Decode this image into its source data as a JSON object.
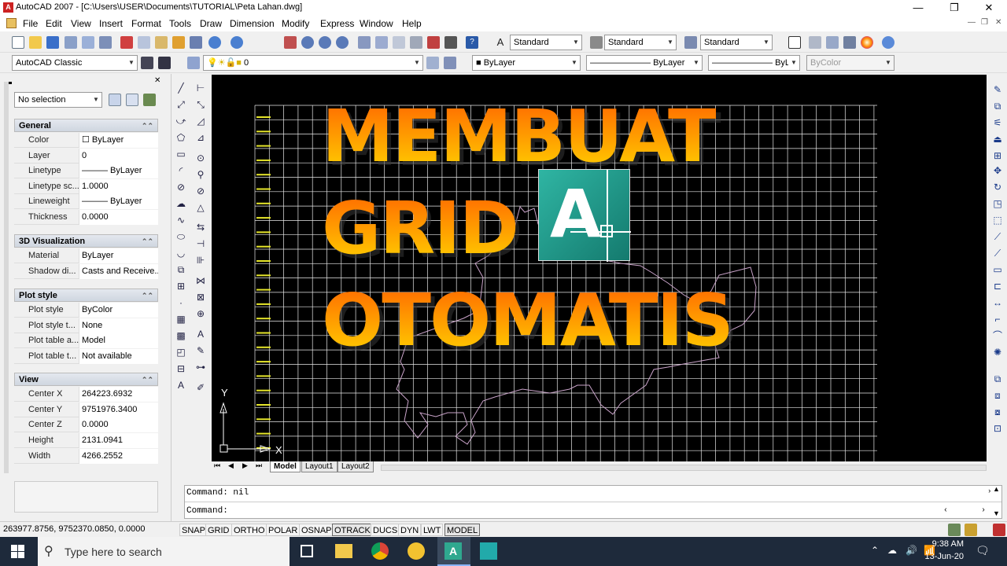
{
  "window": {
    "app_icon": "A",
    "title": "AutoCAD 2007 - [C:\\Users\\USER\\Documents\\TUTORIAL\\Peta Lahan.dwg]",
    "min": "—",
    "max": "❐",
    "close": "✕"
  },
  "menu": {
    "items": [
      "File",
      "Edit",
      "View",
      "Insert",
      "Format",
      "Tools",
      "Draw",
      "Dimension",
      "Modify",
      "Express",
      "Window",
      "Help"
    ],
    "doc_min": "—",
    "doc_max": "❐",
    "doc_close": "✕"
  },
  "toolbar1": {
    "text_style": "Standard",
    "dim_style": "Standard",
    "table_style": "Standard"
  },
  "toolbar2": {
    "workspace": "AutoCAD Classic",
    "layer": "0",
    "color": "ByLayer",
    "linetype": "ByLayer",
    "lineweight": "ByLayer",
    "plotstyle": "ByColor"
  },
  "properties": {
    "selection": "No selection",
    "sections": [
      {
        "title": "General",
        "rows": [
          [
            "Color",
            "☐ ByLayer"
          ],
          [
            "Layer",
            "0"
          ],
          [
            "Linetype",
            "——— ByLayer"
          ],
          [
            "Linetype sc...",
            "1.0000"
          ],
          [
            "Lineweight",
            "——— ByLayer"
          ],
          [
            "Thickness",
            "0.0000"
          ]
        ]
      },
      {
        "title": "3D Visualization",
        "rows": [
          [
            "Material",
            "ByLayer"
          ],
          [
            "Shadow di...",
            "Casts and Receive..."
          ]
        ]
      },
      {
        "title": "Plot style",
        "rows": [
          [
            "Plot style",
            "ByColor"
          ],
          [
            "Plot style t...",
            "None"
          ],
          [
            "Plot table a...",
            "Model"
          ],
          [
            "Plot table t...",
            "Not available"
          ]
        ]
      },
      {
        "title": "View",
        "rows": [
          [
            "Center X",
            "264223.6932"
          ],
          [
            "Center Y",
            "9751976.3400"
          ],
          [
            "Center Z",
            "0.0000"
          ],
          [
            "Height",
            "2131.0941"
          ],
          [
            "Width",
            "4266.2552"
          ]
        ]
      }
    ]
  },
  "overlay": {
    "line1": "MEMBUAT",
    "line2": "GRID",
    "line3": "OTOMATIS",
    "logo_letter": "A"
  },
  "ucs": {
    "y": "Y",
    "x": "X"
  },
  "tabs": {
    "nav": [
      "⏮",
      "◀",
      "▶",
      "⏭"
    ],
    "items": [
      "Model",
      "Layout1",
      "Layout2"
    ],
    "active": "Model"
  },
  "command": {
    "history": "Command: nil",
    "prompt": "Command:"
  },
  "status": {
    "coords": "263977.8756, 9752370.0850, 0.0000",
    "buttons": [
      "SNAP",
      "GRID",
      "ORTHO",
      "POLAR",
      "OSNAP",
      "OTRACK",
      "DUCS",
      "DYN",
      "LWT",
      "MODEL"
    ]
  },
  "taskbar": {
    "search_placeholder": "Type here to search",
    "time": "9:38 AM",
    "date": "13-Jun-20"
  },
  "colors": {
    "canvas": "#000000",
    "grid": "#e8e8e8",
    "boundary": "#c9a3c9",
    "title_top": "#ff6a00",
    "title_bottom": "#ffd000",
    "logo": "#1f9a8a"
  }
}
